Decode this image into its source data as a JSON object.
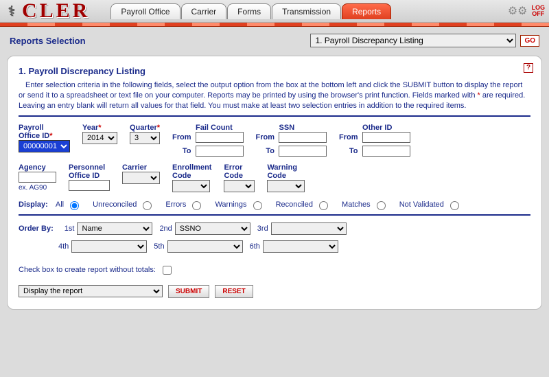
{
  "brand": "CLER",
  "tabs": [
    "Payroll Office",
    "Carrier",
    "Forms",
    "Transmission",
    "Reports"
  ],
  "active_tab": 4,
  "logoff": "LOG\nOFF",
  "subhead_title": "Reports Selection",
  "report_select": "1. Payroll Discrepancy Listing",
  "go": "GO",
  "panel_title": "1. Payroll Discrepancy Listing",
  "intro_parts": {
    "p1": "Enter selection criteria in the following fields, select the output option from the box at the bottom left and click the SUBMIT button to display the report or send it to a spreadsheet or text file on your computer.  Reports may be printed by using the browser's print function.  Fields marked with ",
    "req": "*",
    "p2": " are required.  Leaving an entry blank will return all values for that field.  You must make at least two selection entries in addition to the required items."
  },
  "labels": {
    "payroll_office_id": "Payroll\nOffice ID",
    "year": "Year",
    "quarter": "Quarter",
    "fail_count": "Fail Count",
    "ssn": "SSN",
    "other_id": "Other ID",
    "from": "From",
    "to": "To",
    "agency": "Agency",
    "personnel_office_id": "Personnel\nOffice ID",
    "carrier": "Carrier",
    "enrollment_code": "Enrollment\nCode",
    "error_code": "Error\nCode",
    "warning_code": "Warning\nCode",
    "display": "Display:",
    "order_by": "Order By:",
    "checkbox": "Check box to create report without totals:",
    "ex_agency": "ex. AG90"
  },
  "values": {
    "payroll_office_id": "00000001",
    "year": "2014",
    "quarter": "3",
    "output_option": "Display the report"
  },
  "display_options": [
    "All",
    "Unreconciled",
    "Errors",
    "Warnings",
    "Reconciled",
    "Matches",
    "Not Validated"
  ],
  "display_selected": 0,
  "order_labels": [
    "1st",
    "2nd",
    "3rd",
    "4th",
    "5th",
    "6th"
  ],
  "order_values": [
    "Name",
    "SSNO",
    "",
    "",
    "",
    ""
  ],
  "buttons": {
    "submit": "SUBMIT",
    "reset": "RESET"
  },
  "help": "?"
}
